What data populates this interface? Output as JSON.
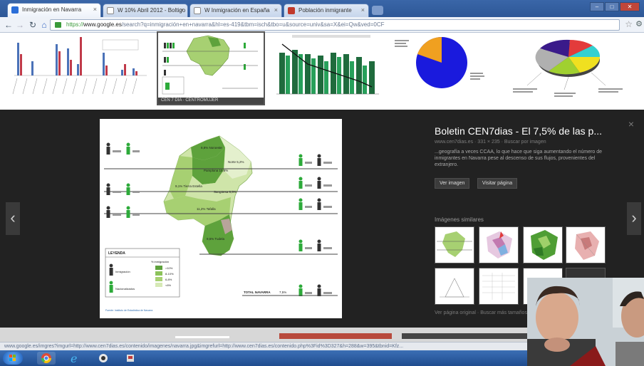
{
  "browser": {
    "tabs": [
      {
        "title": "Inmigración en Navarra",
        "color": "#2b6ed8"
      },
      {
        "title": "W 10% Abril 2012 - Boltigo",
        "color": "#ffffff"
      },
      {
        "title": "W Inmigración en España",
        "color": "#ffffff"
      },
      {
        "title": "Población inmigrante",
        "color": "#c0392b"
      }
    ],
    "url_prefix": "https://",
    "url_domain": "www.google.es",
    "url_rest": "/search?q=inmigración+en+navarra&hl=es-419&tbm=isch&tbo=u&source=univ&sa=X&ei=Qw&ved=0CF"
  },
  "image_strip": {
    "selected_caption": "CEN 7 DÍA  ·  CENTROMUJER"
  },
  "lightbox": {
    "title": "Boletin CEN7dias - El 7,5% de las p...",
    "source_line": "www.cen7dias.es  ·  331 × 235  ·  Buscar por imagen",
    "description": "...geografía a veces CCAA, lo que hace que siga aumentando el número de inmigrantes en Navarra pese al descenso de sus flujos, provenientes del extranjero.",
    "view_image_label": "Ver imagen",
    "visit_page_label": "Visitar página",
    "similar_heading": "Imágenes similares",
    "footer_links": "Ver página original  ·  Buscar más tamaños",
    "close_glyph": "×",
    "prev_glyph": "‹",
    "next_glyph": "›"
  },
  "map_card": {
    "legend_title": "LEYENDA",
    "legend_col_header": "% inmigración",
    "legend_person1": "Inmigración",
    "legend_person2": "Nacionalizados",
    "legend_ranges": [
      ">10%",
      "8-10%",
      "6-8%",
      "<6%"
    ],
    "total_label": "TOTAL NAVARRA",
    "total_value": "7,5%",
    "footer": "Fuente: Instituto de Estadística de Navarra",
    "zone_labels": [
      "8,8% Noroeste",
      "Norte 5,2%",
      "Pamplona 15,8%",
      "9,1% Tierra Estella",
      "Sangüesa 8,5%",
      "11,2% Tafalla",
      "9,5% Tudela"
    ]
  },
  "status_url": "www.google.es/imgres?imgurl=http://www.cen7dias.es/contenido/imagenes/navarra.jpg&imgrefurl=http://www.cen7dias.es/contenido.php%3Fid%3D327&h=288&w=395&tbnid=Kfz...",
  "colors": {
    "lightbox_bg": "#222222",
    "map_light": "#d6e9b6",
    "map_mid": "#a7d072",
    "map_dark": "#5ea23c",
    "green_person": "#2daa3a",
    "dark_person": "#333333"
  }
}
